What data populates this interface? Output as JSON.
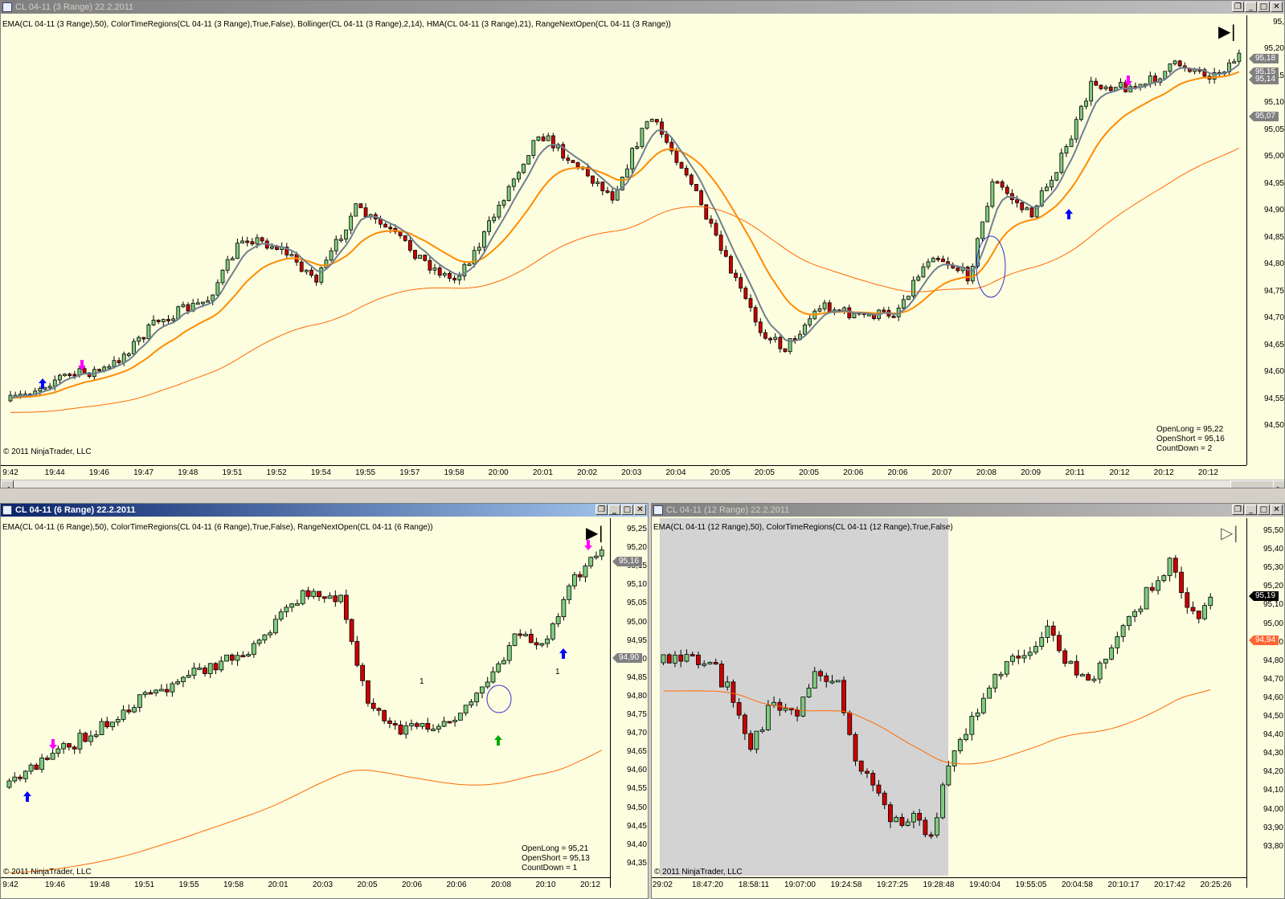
{
  "top": {
    "title": "CL 04-11 (3 Range)  22.2.2011",
    "indicators": "EMA(CL 04-11 (3 Range),50), ColorTimeRegions(CL 04-11 (3 Range),True,False), Bollinger(CL 04-11 (3 Range),2,14), HMA(CL 04-11 (3 Range),21), RangeNextOpen(CL 04-11 (3 Range))",
    "copyright": "© 2011 NinjaTrader, LLC",
    "info": [
      "OpenLong = 95,22",
      "OpenShort = 95,16",
      "CountDown = 2"
    ],
    "yticks": [
      "95,20",
      "95,15",
      "95,10",
      "95,05",
      "95,00",
      "94,95",
      "94,90",
      "94,85",
      "94,80",
      "94,75",
      "94,70",
      "94,65",
      "94,60",
      "94,55",
      "94,50"
    ],
    "yticks_partial_top": "95,",
    "price_tags": [
      {
        "label": "95,18",
        "color": "#808080"
      },
      {
        "label": "95,15",
        "color": "#808080"
      },
      {
        "label": "95,14",
        "color": "#808080"
      },
      {
        "label": "95,07",
        "color": "#808080"
      }
    ],
    "xticks": [
      "9:42",
      "19:44",
      "19:46",
      "19:47",
      "19:48",
      "19:51",
      "19:52",
      "19:54",
      "19:55",
      "19:57",
      "19:58",
      "20:00",
      "20:01",
      "20:02",
      "20:03",
      "20:04",
      "20:05",
      "20:05",
      "20:05",
      "20:06",
      "20:06",
      "20:07",
      "20:08",
      "20:09",
      "20:11",
      "20:12",
      "20:12",
      "20:12"
    ]
  },
  "bottom_left": {
    "title": "CL 04-11 (6 Range)  22.2.2011",
    "indicators": "EMA(CL 04-11 (6 Range),50), ColorTimeRegions(CL 04-11 (6 Range),True,False), RangeNextOpen(CL 04-11 (6 Range))",
    "copyright": "© 2011 NinjaTrader, LLC",
    "info": [
      "OpenLong = 95,21",
      "OpenShort = 95,13",
      "CountDown = 1"
    ],
    "yticks": [
      "95,25",
      "95,20",
      "95,15",
      "95,10",
      "95,05",
      "95,00",
      "94,95",
      "94,90",
      "94,85",
      "94,80",
      "94,75",
      "94,70",
      "94,65",
      "94,60",
      "94,55",
      "94,50",
      "94,45",
      "94,40",
      "94,35"
    ],
    "price_tags": [
      {
        "label": "95,16",
        "color": "#808080"
      },
      {
        "label": "94,90",
        "color": "#808080"
      }
    ],
    "xticks": [
      "9:42",
      "19:46",
      "19:48",
      "19:51",
      "19:55",
      "19:58",
      "20:01",
      "20:03",
      "20:05",
      "20:06",
      "20:06",
      "20:08",
      "20:10",
      "20:12"
    ],
    "counter_labels": [
      "1",
      "1"
    ]
  },
  "bottom_right": {
    "title": "CL 04-11 (12 Range)  22.2.2011",
    "indicators": "EMA(CL 04-11 (12 Range),50), ColorTimeRegions(CL 04-11 (12 Range),True,False)",
    "copyright": "© 2011 NinjaTrader, LLC",
    "yticks": [
      "95,50",
      "95,40",
      "95,30",
      "95,20",
      "95,10",
      "95,00",
      "94,90",
      "94,80",
      "94,70",
      "94,60",
      "94,50",
      "94,40",
      "94,30",
      "94,20",
      "94,10",
      "94,00",
      "93,90",
      "93,80"
    ],
    "price_tags": [
      {
        "label": "95,19",
        "color": "#000000"
      },
      {
        "label": "94,94",
        "color": "#ff6633"
      }
    ],
    "xticks": [
      ":29:02",
      "18:47:20",
      "18:58:11",
      "19:07:00",
      "19:24:58",
      "19:27:25",
      "19:28:48",
      "19:40:04",
      "19:55:05",
      "20:04:58",
      "20:10:17",
      "20:17:42",
      "20:25:26"
    ]
  },
  "colors": {
    "up_candle": "#7fcc7f",
    "down_candle": "#cc0000",
    "ema": "#ff6a00",
    "hma": "#708090",
    "bollinger_mid": "#ff8c00",
    "arrow_long": "#0000ff",
    "arrow_short": "#ff00ff",
    "arrow_signal": "#00aa00",
    "session_shade": "#d3d3d3",
    "chart_bg": "#fdfde0"
  },
  "window_buttons": {
    "restore": "❐",
    "minimize": "_",
    "maximize": "□",
    "close": "✕"
  },
  "icons": {
    "play_end": "play-end-icon",
    "scroll_left": "◄",
    "scroll_right": "►"
  }
}
